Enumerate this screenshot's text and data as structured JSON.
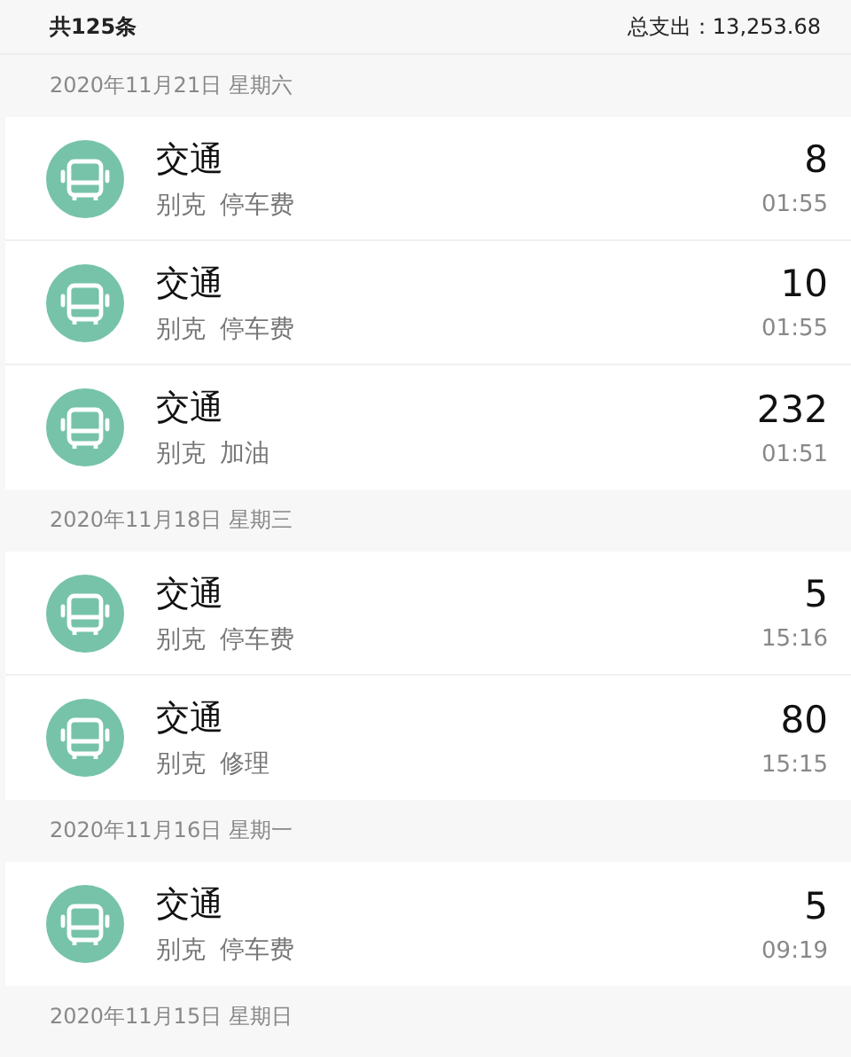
{
  "summary": {
    "count": "共125条",
    "total": "总支出：13,253.68"
  },
  "days": [
    {
      "date": "2020年11月21日 星期六",
      "entries": [
        {
          "category": "交通",
          "account": "别克",
          "tag": "停车费",
          "amount": "8",
          "time": "01:55"
        },
        {
          "category": "交通",
          "account": "别克",
          "tag": "停车费",
          "amount": "10",
          "time": "01:55"
        },
        {
          "category": "交通",
          "account": "别克",
          "tag": "加油",
          "amount": "232",
          "time": "01:51"
        }
      ]
    },
    {
      "date": "2020年11月18日 星期三",
      "entries": [
        {
          "category": "交通",
          "account": "别克",
          "tag": "停车费",
          "amount": "5",
          "time": "15:16"
        },
        {
          "category": "交通",
          "account": "别克",
          "tag": "修理",
          "amount": "80",
          "time": "15:15"
        }
      ]
    },
    {
      "date": "2020年11月16日 星期一",
      "entries": [
        {
          "category": "交通",
          "account": "别克",
          "tag": "停车费",
          "amount": "5",
          "time": "09:19"
        }
      ]
    },
    {
      "date": "2020年11月15日 星期日"
    }
  ]
}
